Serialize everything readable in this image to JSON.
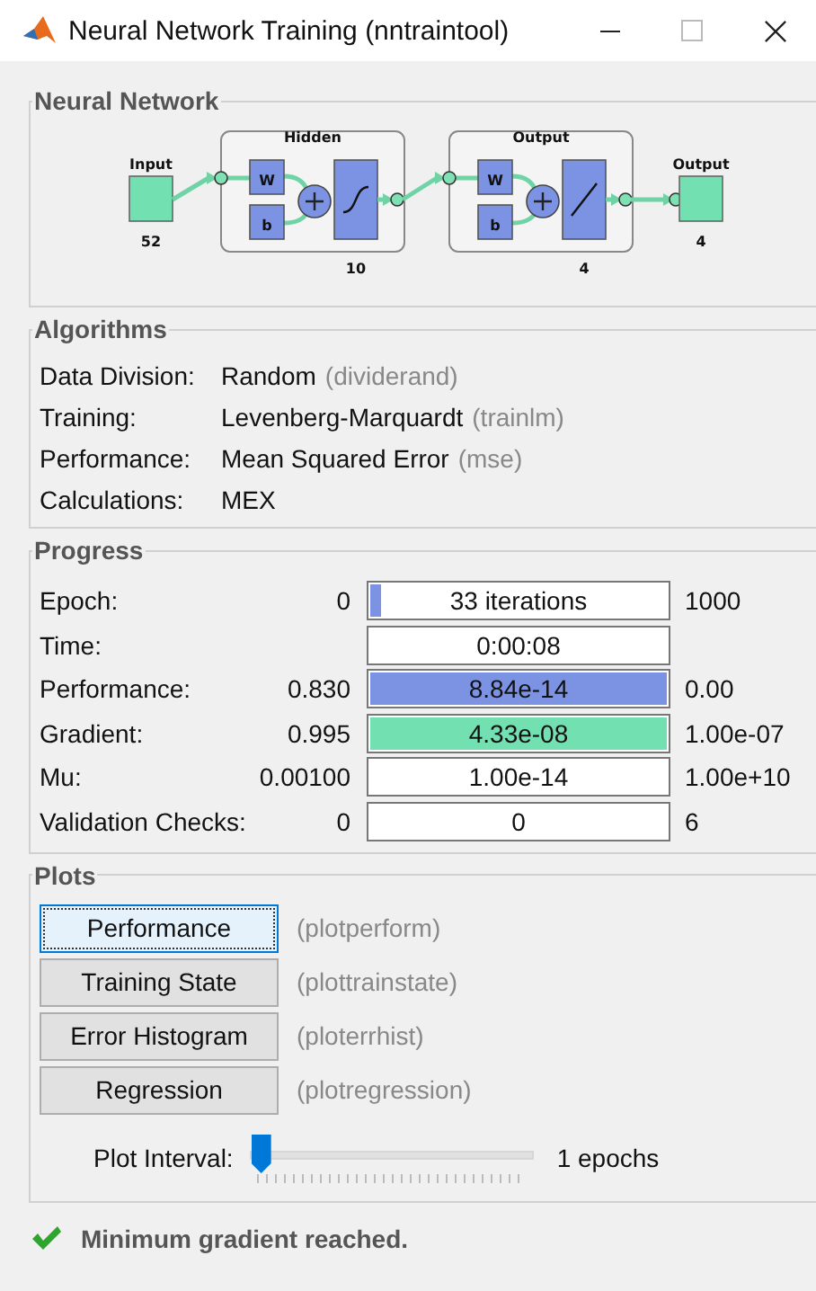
{
  "window": {
    "title": "Neural Network Training (nntraintool)"
  },
  "network": {
    "title": "Neural Network",
    "input": {
      "label": "Input",
      "size": "52"
    },
    "layers": [
      {
        "title": "Hidden",
        "size": "10",
        "weight": "W",
        "bias": "b",
        "kind": "sigmoid"
      },
      {
        "title": "Output",
        "size": "4",
        "weight": "W",
        "bias": "b",
        "kind": "linear"
      }
    ],
    "output": {
      "label": "Output",
      "size": "4"
    }
  },
  "algorithms": {
    "title": "Algorithms",
    "rows": [
      {
        "label": "Data Division:",
        "value": "Random",
        "function": "(dividerand)"
      },
      {
        "label": "Training:",
        "value": "Levenberg-Marquardt",
        "function": "(trainlm)"
      },
      {
        "label": "Performance:",
        "value": "Mean Squared Error",
        "function": "(mse)"
      },
      {
        "label": "Calculations:",
        "value": "MEX"
      }
    ]
  },
  "progress": {
    "title": "Progress",
    "rows": [
      {
        "label": "Epoch:",
        "start": "0",
        "value": "33 iterations",
        "end": "1000",
        "level": 0.033,
        "color": "#7b93e2"
      },
      {
        "label": "Time:",
        "value": "0:00:08"
      },
      {
        "label": "Performance:",
        "start": "0.830",
        "value": "8.84e-14",
        "end": "0.00",
        "level": 1,
        "color": "#7b93e2"
      },
      {
        "label": "Gradient:",
        "start": "0.995",
        "value": "4.33e-08",
        "end": "1.00e-07",
        "level": 1,
        "color": "#72e0b0"
      },
      {
        "label": "Mu:",
        "start": "0.00100",
        "value": "1.00e-14",
        "end": "1.00e+10"
      },
      {
        "label": "Validation Checks:",
        "start": "0",
        "value": "0",
        "end": "6"
      }
    ]
  },
  "plots": {
    "title": "Plots",
    "buttons": [
      {
        "label": "Performance",
        "function": "(plotperform)",
        "selected": true
      },
      {
        "label": "Training State",
        "function": "(plottrainstate)",
        "selected": false
      },
      {
        "label": "Error Histogram",
        "function": "(ploterrhist)",
        "selected": false
      },
      {
        "label": "Regression",
        "function": "(plotregression)",
        "selected": false
      }
    ],
    "interval": {
      "label": "Plot Interval:",
      "level": 0,
      "reading": "1 epochs"
    }
  },
  "status": {
    "kind": "success",
    "message": "Minimum gradient reached."
  }
}
